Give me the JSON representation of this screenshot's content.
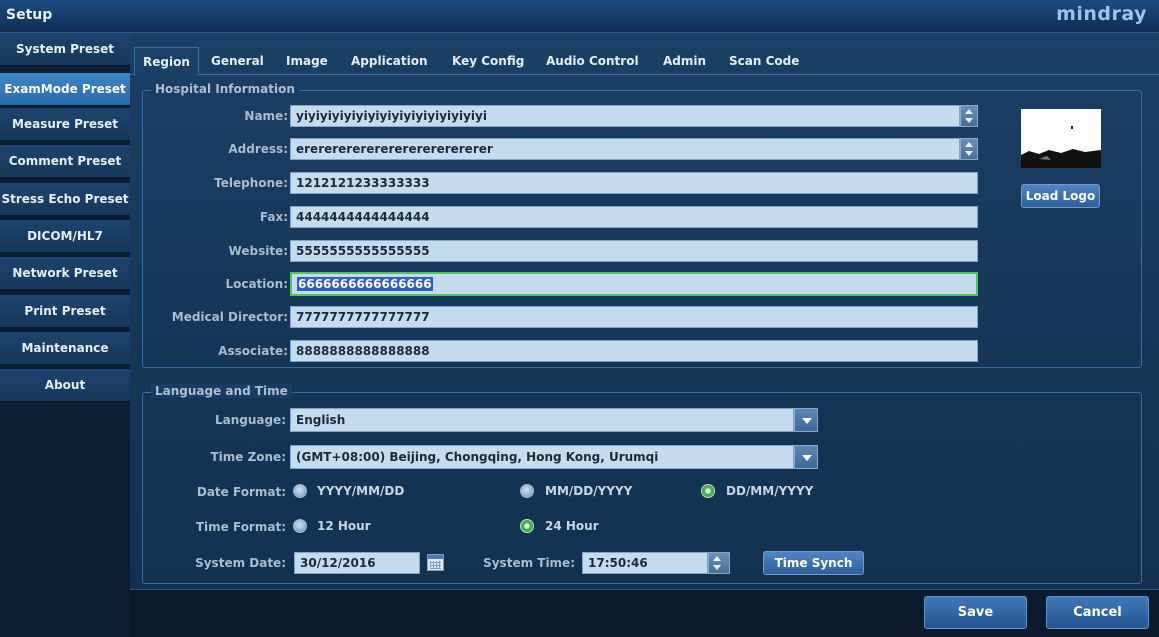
{
  "window": {
    "title": "Setup",
    "brand": "mindray"
  },
  "sidebar": {
    "items": [
      {
        "label": "System Preset"
      },
      {
        "label": "ExamMode Preset",
        "active": true
      },
      {
        "label": "Measure Preset"
      },
      {
        "label": "Comment Preset"
      },
      {
        "label": "Stress Echo Preset"
      },
      {
        "label": "DICOM/HL7"
      },
      {
        "label": "Network Preset"
      },
      {
        "label": "Print Preset"
      },
      {
        "label": "Maintenance"
      },
      {
        "label": "About"
      }
    ]
  },
  "tabs": [
    {
      "label": "Region",
      "active": true
    },
    {
      "label": "General"
    },
    {
      "label": "Image"
    },
    {
      "label": "Application"
    },
    {
      "label": "Key Config"
    },
    {
      "label": "Audio Control"
    },
    {
      "label": "Admin"
    },
    {
      "label": "Scan Code"
    }
  ],
  "hospital": {
    "title": "Hospital Information",
    "fields": [
      {
        "label": "Name:",
        "value": "yiyiyiyiyiyiyiyiyiyiyiyiyiyiyiyi"
      },
      {
        "label": "Address:",
        "value": "erererererererererererererer"
      },
      {
        "label": "Telephone:",
        "value": "1212121233333333"
      },
      {
        "label": "Fax:",
        "value": "4444444444444444"
      },
      {
        "label": "Website:",
        "value": "5555555555555555"
      },
      {
        "label": "Location:",
        "value": "6666666666666666"
      },
      {
        "label": "Medical Director:",
        "value": "7777777777777777"
      },
      {
        "label": "Associate:",
        "value": "8888888888888888"
      }
    ],
    "load_logo": "Load Logo"
  },
  "language_time": {
    "title": "Language and Time",
    "language_label": "Language:",
    "language_value": "English",
    "timezone_label": "Time Zone:",
    "timezone_value": "(GMT+08:00) Beijing, Chongqing, Hong Kong, Urumqi",
    "date_format_label": "Date Format:",
    "date_formats": [
      "YYYY/MM/DD",
      "MM/DD/YYYY",
      "DD/MM/YYYY"
    ],
    "date_format_selected": "DD/MM/YYYY",
    "time_format_label": "Time Format:",
    "time_formats": [
      "12 Hour",
      "24 Hour"
    ],
    "time_format_selected": "24 Hour",
    "system_date_label": "System Date:",
    "system_date_value": "30/12/2016",
    "system_time_label": "System Time:",
    "system_time_value": "17:50:46",
    "time_synch": "Time Synch"
  },
  "footer": {
    "save": "Save",
    "cancel": "Cancel"
  }
}
